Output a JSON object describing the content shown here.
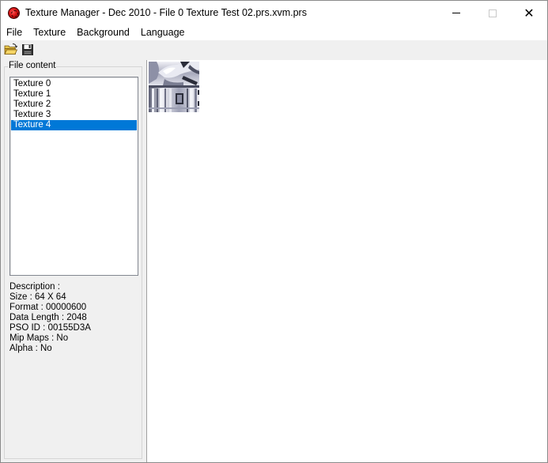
{
  "window": {
    "title": "Texture Manager - Dec 2010 - File 0 Texture Test 02.prs.xvm.prs",
    "icon": "app-disc-icon",
    "controls": {
      "minimize": "minimize-icon",
      "maximize": "maximize-icon",
      "close": "✕"
    }
  },
  "menu": {
    "items": [
      "File",
      "Texture",
      "Background",
      "Language"
    ]
  },
  "toolbar": {
    "buttons": [
      {
        "name": "open",
        "icon": "folder-open-icon"
      },
      {
        "name": "save",
        "icon": "floppy-disk-icon"
      }
    ]
  },
  "file_content": {
    "label": "File content",
    "textures": [
      "Texture 0",
      "Texture 1",
      "Texture 2",
      "Texture 3",
      "Texture 4"
    ],
    "selected_index": 4,
    "selection_color": "#0078d7"
  },
  "description": {
    "heading": "Description :",
    "size": "Size : 64 X 64",
    "format": "Format : 00000600",
    "data_length": "Data Length : 2048",
    "pso_id": "PSO ID : 00155D3A",
    "mip_maps": "Mip Maps : No",
    "alpha": "Alpha : No"
  },
  "preview": {
    "description": "64x64 texture preview",
    "colors": {
      "base": "#cfd0dc",
      "dark": "#2b2d3a",
      "light": "#f4f4f8"
    }
  }
}
